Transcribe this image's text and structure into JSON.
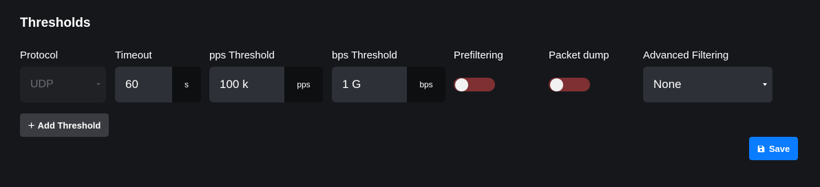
{
  "section": {
    "title": "Thresholds"
  },
  "fields": {
    "protocol": {
      "label": "Protocol",
      "value": "UDP"
    },
    "timeout": {
      "label": "Timeout",
      "value": "60",
      "unit": "s"
    },
    "pps": {
      "label": "pps Threshold",
      "value": "100 k",
      "unit": "pps"
    },
    "bps": {
      "label": "bps Threshold",
      "value": "1 G",
      "unit": "bps"
    },
    "prefiltering": {
      "label": "Prefiltering",
      "enabled": false
    },
    "packet_dump": {
      "label": "Packet dump",
      "enabled": false
    },
    "advanced_filtering": {
      "label": "Advanced Filtering",
      "value": "None"
    }
  },
  "actions": {
    "add_threshold_label": "Add Threshold",
    "save_label": "Save"
  },
  "colors": {
    "background": "#16171b",
    "input_bg": "#2d3036",
    "toggle_off": "#7e3032",
    "primary": "#0a7cff"
  },
  "icons": {
    "add": "plus-icon",
    "save": "floppy-disk-icon"
  }
}
